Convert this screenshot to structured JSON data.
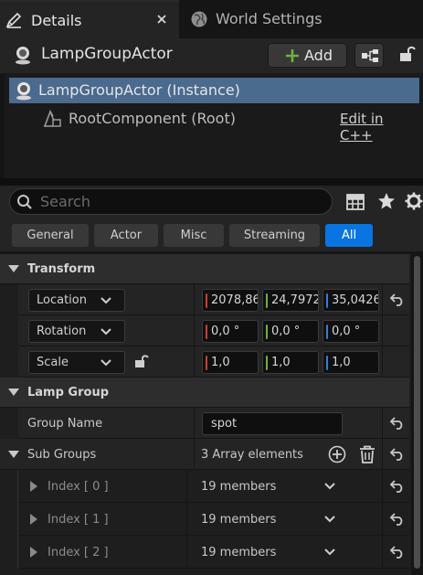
{
  "tabs": [
    {
      "label": "Details",
      "active": true
    },
    {
      "label": "World Settings",
      "active": false
    }
  ],
  "header": {
    "actor_name": "LampGroupActor",
    "add_label": "Add"
  },
  "components": [
    {
      "label": "LampGroupActor (Instance)",
      "selected": true
    },
    {
      "label": "RootComponent (Root)",
      "action": "Edit in C++"
    }
  ],
  "search": {
    "placeholder": "Search"
  },
  "filters": [
    "General",
    "Actor",
    "Misc",
    "Streaming",
    "All"
  ],
  "active_filter": "All",
  "transform": {
    "category": "Transform",
    "location": {
      "mode": "Location",
      "x": "2078,86",
      "y": "24,7972",
      "z": "35,0426"
    },
    "rotation": {
      "mode": "Rotation",
      "x": "0,0 °",
      "y": "0,0 °",
      "z": "0,0 °"
    },
    "scale": {
      "mode": "Scale",
      "x": "1,0",
      "y": "1,0",
      "z": "1,0"
    }
  },
  "lamp_group": {
    "category": "Lamp Group",
    "group_name_label": "Group Name",
    "group_name_value": "spot",
    "sub_groups_label": "Sub Groups",
    "sub_groups_summary": "3 Array elements",
    "elements": [
      {
        "index": "Index [ 0 ]",
        "value": "19 members"
      },
      {
        "index": "Index [ 1 ]",
        "value": "19 members"
      },
      {
        "index": "Index [ 2 ]",
        "value": "19 members"
      }
    ]
  },
  "colors": {
    "accent": "#0a74e0",
    "selection": "#4a6a8e",
    "axis_x": "#d93a2a",
    "axis_y": "#6cb33a",
    "axis_z": "#2f7ee0",
    "add_icon": "#6cb33a"
  }
}
